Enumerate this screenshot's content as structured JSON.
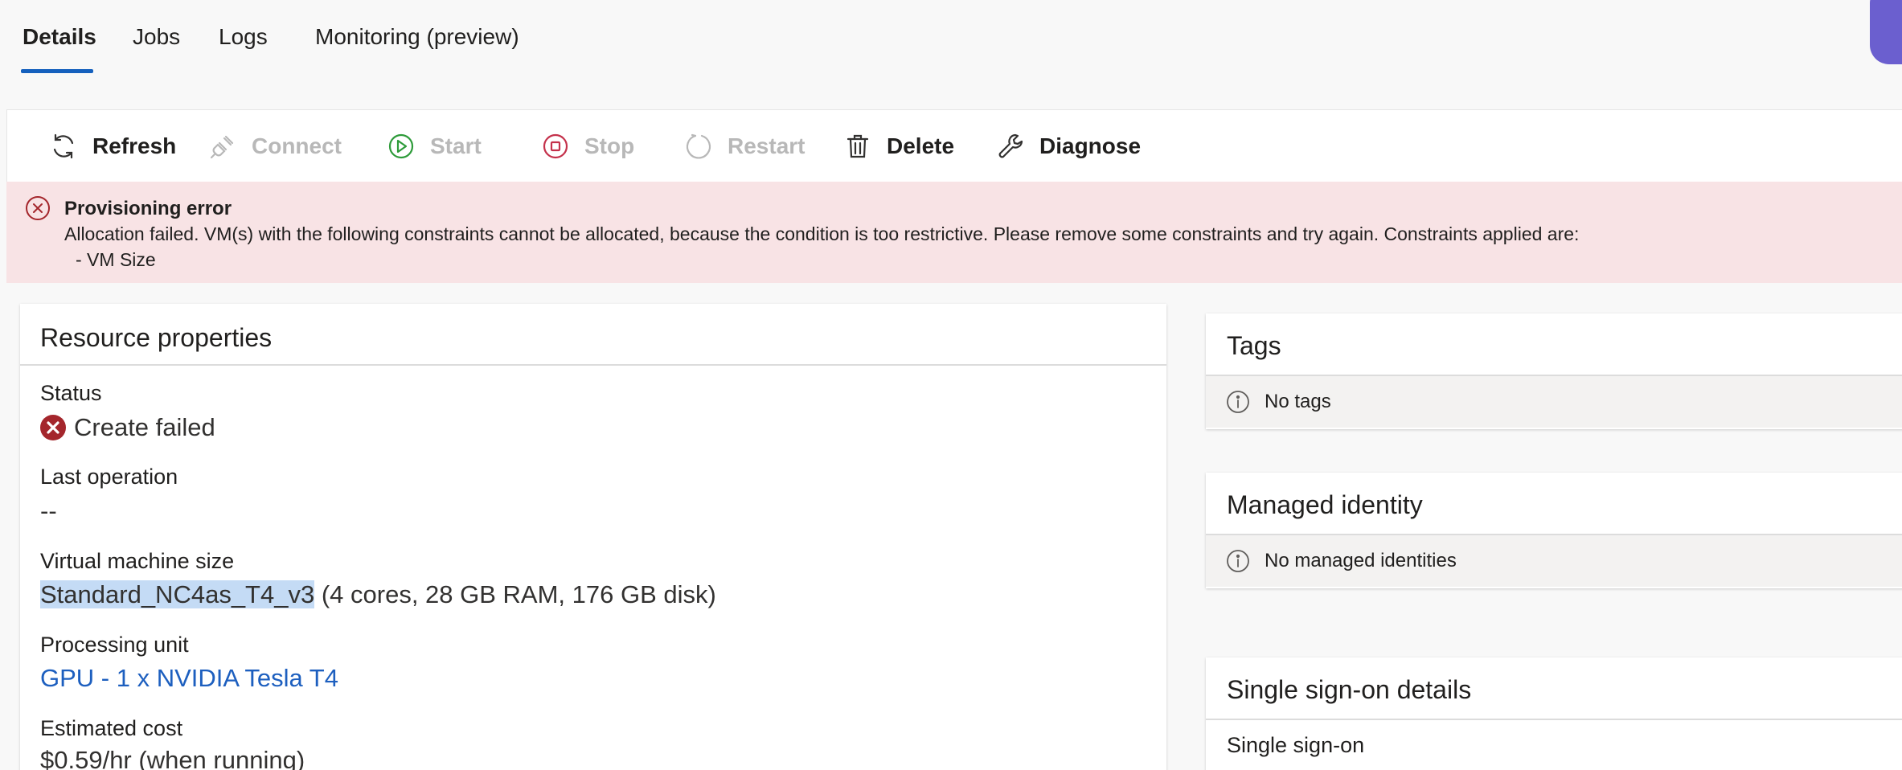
{
  "tabs": [
    {
      "label": "Details",
      "active": true
    },
    {
      "label": "Jobs",
      "active": false
    },
    {
      "label": "Logs",
      "active": false
    },
    {
      "label": "Monitoring (preview)",
      "active": false
    }
  ],
  "toolbar": {
    "refresh": "Refresh",
    "connect": "Connect",
    "start": "Start",
    "stop": "Stop",
    "restart": "Restart",
    "delete": "Delete",
    "diagnose": "Diagnose"
  },
  "error_banner": {
    "title": "Provisioning error",
    "message": "Allocation failed. VM(s) with the following constraints cannot be allocated, because the condition is too restrictive. Please remove some constraints and try again. Constraints applied are:",
    "bullet": "- VM Size",
    "color": "#f8e3e5"
  },
  "resource_properties": {
    "title": "Resource properties",
    "status_label": "Status",
    "status_value": "Create failed",
    "last_operation_label": "Last operation",
    "last_operation_value": "--",
    "vm_size_label": "Virtual machine size",
    "vm_size_name": "Standard_NC4as_T4_v3",
    "vm_size_detail": " (4 cores, 28 GB RAM, 176 GB disk)",
    "processing_unit_label": "Processing unit",
    "processing_unit_value": "GPU - 1 x NVIDIA Tesla T4",
    "estimated_cost_label": "Estimated cost",
    "estimated_cost_value": "$0.59/hr (when running)"
  },
  "tags": {
    "title": "Tags",
    "empty_text": "No tags"
  },
  "managed_identity": {
    "title": "Managed identity",
    "empty_text": "No managed identities"
  },
  "sso": {
    "title": "Single sign-on details",
    "label": "Single sign-on"
  },
  "colors": {
    "accent": "#1560bd",
    "link": "#1d5fbf",
    "error": "#a4262c",
    "disabled": "#b8b8b8"
  }
}
